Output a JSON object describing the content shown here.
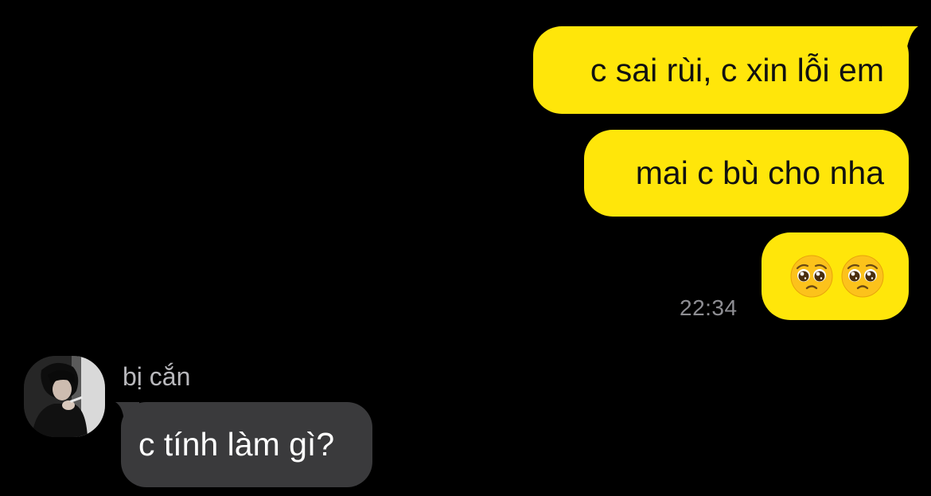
{
  "messages": {
    "outgoing": [
      {
        "text": "c sai rùi, c xin lỗi em"
      },
      {
        "text": "mai c bù cho nha"
      },
      {
        "emoji": [
          "pleading-face-emoji",
          "pleading-face-emoji"
        ]
      }
    ],
    "timestamp": "22:34",
    "incoming": {
      "sender": "bị cắn",
      "text": "c tính làm gì?"
    }
  },
  "colors": {
    "background": "#000000",
    "outgoing_bubble": "#FFE60A",
    "incoming_bubble": "#3A3A3C",
    "timestamp": "#8E8E93"
  }
}
